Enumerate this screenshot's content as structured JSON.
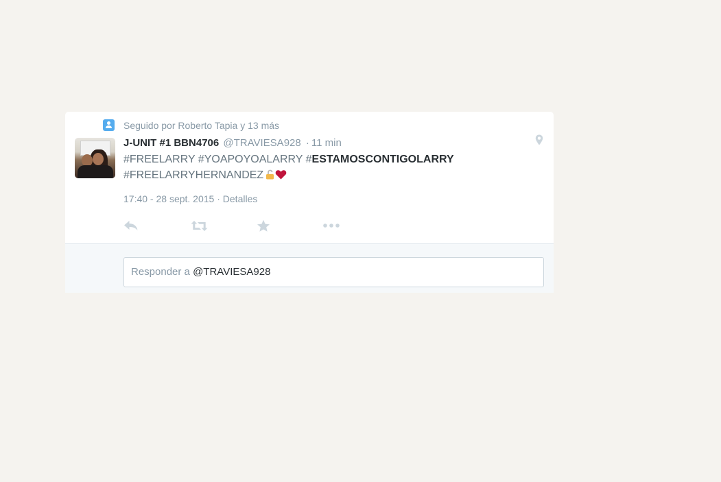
{
  "context": {
    "icon": "person-icon",
    "prefix": "Seguido por",
    "name": "Roberto Tapia",
    "suffix": "y 13 más"
  },
  "tweet": {
    "fullname": "J-UNIT #1 BBN4706",
    "username": "@TRAVIESA928",
    "separator": "·",
    "time": "11 min",
    "hashtags": [
      "#FREELARRY",
      "#YOAPOYOALARRY",
      "#ESTAMOSCONTIGOLARRY",
      "#FREELARRYHERNANDEZ"
    ],
    "emoji": [
      "unlocked-lock-icon",
      "red-heart-icon"
    ],
    "date": "17:40 - 28 sept. 2015",
    "meta_separator": "·",
    "details_link": "Detalles"
  },
  "actions": {
    "reply": "reply-icon",
    "retweet": "retweet-icon",
    "favorite": "star-icon",
    "more": "more-icon"
  },
  "reply_box": {
    "placeholder_prefix": "Responder a",
    "mention": "@TRAVIESA928"
  },
  "colors": {
    "background": "#f5f3ef",
    "card": "#ffffff",
    "accent": "#55acee",
    "muted": "#8899a6",
    "heart": "#c0143c"
  }
}
